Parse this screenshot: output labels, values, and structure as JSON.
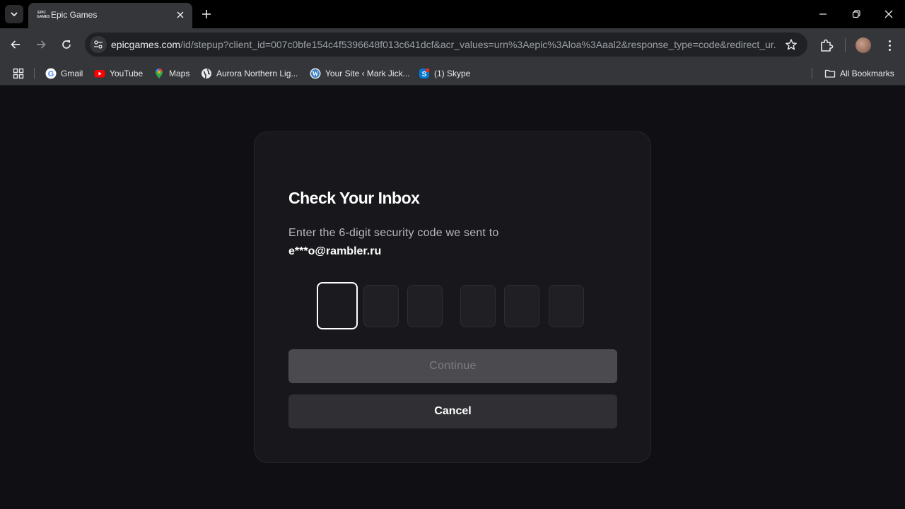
{
  "browser": {
    "tab": {
      "title": "Epic Games",
      "favicon_text": "EPIC GAMES"
    },
    "url": {
      "host": "epicgames.com",
      "path": "/id/stepup?client_id=007c0bfe154c4f5396648f013c641dcf&acr_values=urn%3Aepic%3Aloa%3Aaal2&response_type=code&redirect_ur..."
    },
    "bookmarks": [
      {
        "label": "Gmail",
        "icon": "google-icon"
      },
      {
        "label": "YouTube",
        "icon": "youtube-icon"
      },
      {
        "label": "Maps",
        "icon": "maps-icon"
      },
      {
        "label": "Aurora Northern Lig...",
        "icon": "globe-icon"
      },
      {
        "label": "Your Site ‹ Mark Jick...",
        "icon": "wordpress-icon"
      },
      {
        "label": "(1) Skype",
        "icon": "skype-icon"
      }
    ],
    "all_bookmarks_label": "All Bookmarks"
  },
  "page": {
    "title": "Check Your Inbox",
    "description": "Enter the 6-digit security code we sent to",
    "email": "e***o@rambler.ru",
    "code_digits": [
      "",
      "",
      "",
      "",
      "",
      ""
    ],
    "continue_label": "Continue",
    "cancel_label": "Cancel"
  },
  "colors": {
    "background": "#101014",
    "card": "#18181c",
    "continue_disabled": "#4a4a4f",
    "cancel": "#303034"
  }
}
